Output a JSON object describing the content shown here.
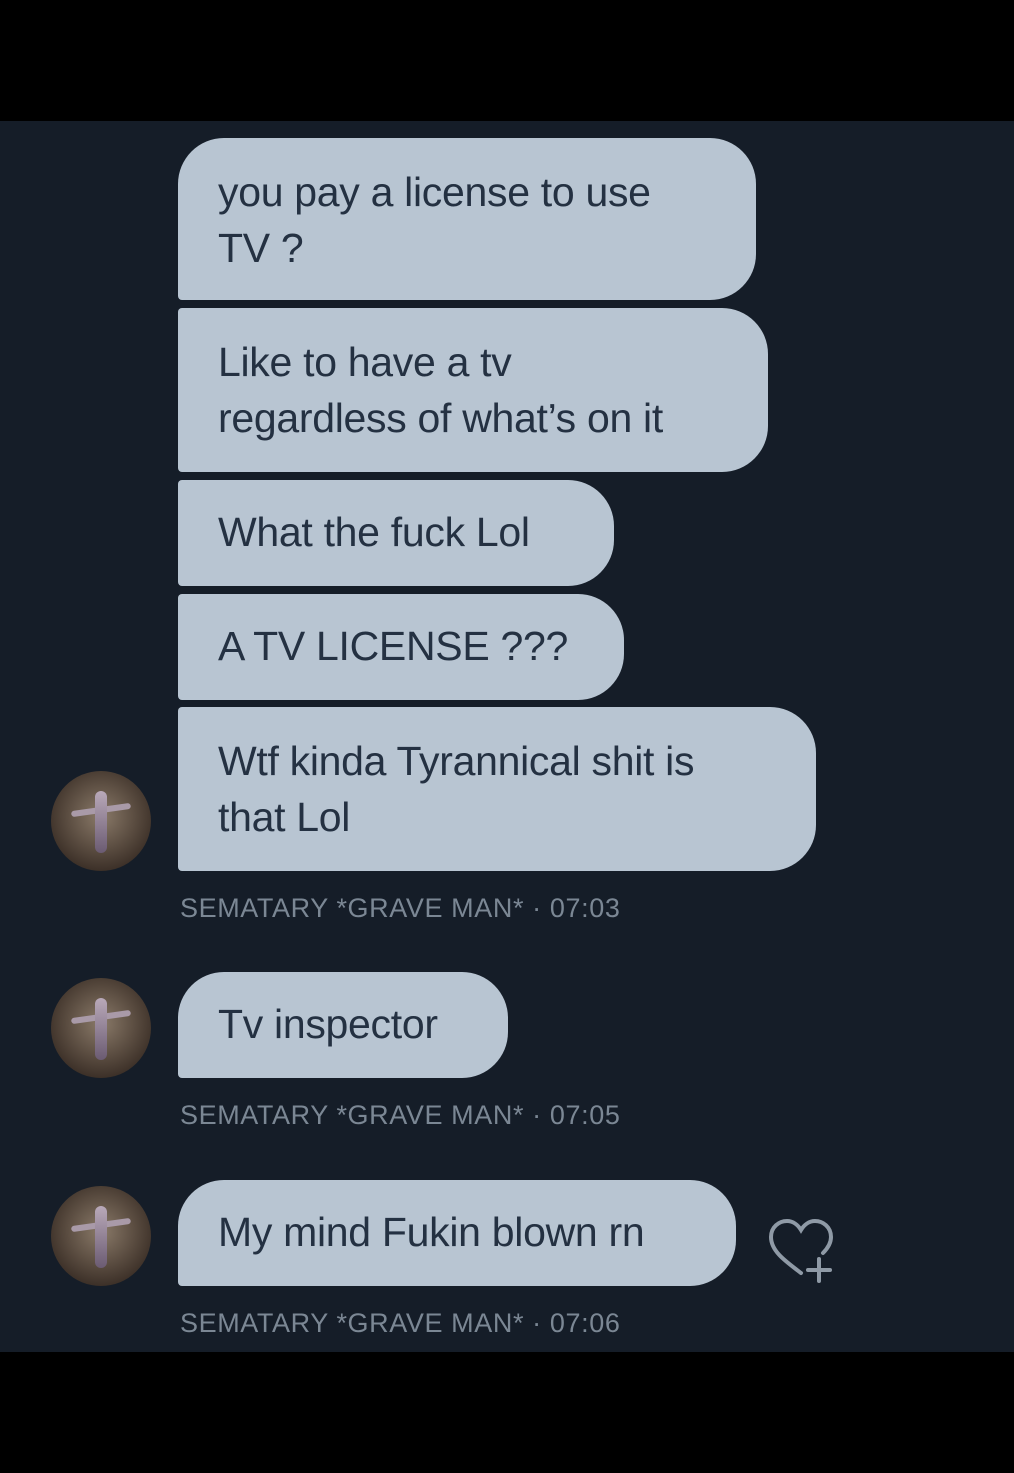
{
  "messages": [
    {
      "text_line1": "you pay a license to use",
      "text_line2": "TV ?"
    },
    {
      "text_line1": "Like to have a tv",
      "text_line2": "regardless of what’s on it"
    },
    {
      "text": "What the fuck Lol"
    },
    {
      "text": "A TV LICENSE ???"
    },
    {
      "text_line1": "Wtf kinda Tyrannical shit is",
      "text_line2": "that Lol"
    },
    {
      "text": "Tv inspector"
    },
    {
      "text": "My mind Fukin blown rn"
    }
  ],
  "meta": [
    "SEMATARY *GRAVE MAN* · 07:03",
    "SEMATARY *GRAVE MAN* · 07:05",
    "SEMATARY *GRAVE MAN* · 07:06"
  ],
  "icons": {
    "avatar": "user-avatar",
    "react": "heart-plus-icon"
  },
  "colors": {
    "background": "#151d28",
    "bubble": "#b8c5d2",
    "bubble_text": "#243142",
    "meta_text": "#7b8794"
  }
}
